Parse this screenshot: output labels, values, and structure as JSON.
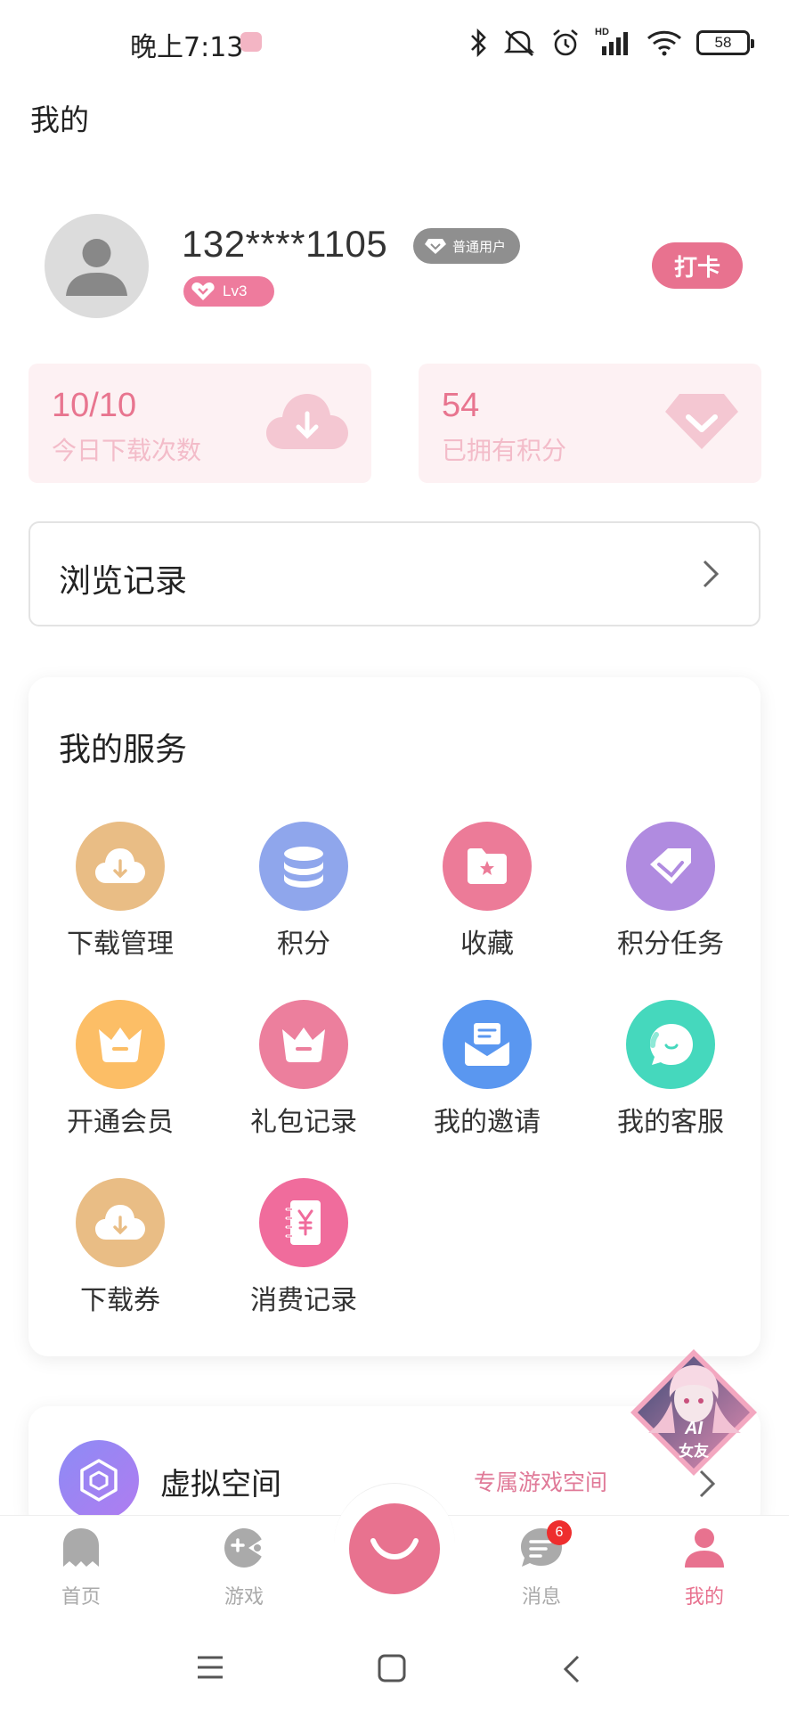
{
  "status_bar": {
    "time": "晚上7:13",
    "battery": "58",
    "network": "HD"
  },
  "page": {
    "title": "我的"
  },
  "profile": {
    "username": "132****1105",
    "user_type": "普通用户",
    "level": "Lv3",
    "checkin_label": "打卡"
  },
  "stats": [
    {
      "value": "10/10",
      "label": "今日下载次数",
      "icon": "cloud-download-icon"
    },
    {
      "value": "54",
      "label": "已拥有积分",
      "icon": "diamond-icon"
    }
  ],
  "history": {
    "label": "浏览记录"
  },
  "services": {
    "title": "我的服务",
    "items": [
      {
        "label": "下载管理",
        "icon": "cloud-download-icon",
        "color": "#e9bd85"
      },
      {
        "label": "积分",
        "icon": "coins-stack-icon",
        "color": "#8fa6ec"
      },
      {
        "label": "收藏",
        "icon": "star-folder-icon",
        "color": "#ec7b98"
      },
      {
        "label": "积分任务",
        "icon": "diamond-icon",
        "color": "#b08be0"
      },
      {
        "label": "开通会员",
        "icon": "crown-icon",
        "color": "#fcbe66"
      },
      {
        "label": "礼包记录",
        "icon": "crown-icon",
        "color": "#ec7f9d"
      },
      {
        "label": "我的邀请",
        "icon": "mail-icon",
        "color": "#5a97f0"
      },
      {
        "label": "我的客服",
        "icon": "chat-bubble-icon",
        "color": "#45d8bd"
      },
      {
        "label": "下载券",
        "icon": "cloud-download-icon",
        "color": "#e9bd85"
      },
      {
        "label": "消费记录",
        "icon": "yuan-notebook-icon",
        "color": "#f06c9c"
      }
    ]
  },
  "virtual_space": {
    "title": "虚拟空间",
    "subtitle": "专属游戏空间"
  },
  "ai_float": {
    "label_line1": "AI",
    "label_line2": "女友"
  },
  "bottom_nav": {
    "items": [
      {
        "label": "首页",
        "icon": "ghost-icon",
        "active": false
      },
      {
        "label": "游戏",
        "icon": "pacman-icon",
        "active": false
      },
      {
        "label": "消息",
        "icon": "message-icon",
        "active": false,
        "badge": "6"
      },
      {
        "label": "我的",
        "icon": "user-icon",
        "active": true
      }
    ]
  },
  "colors": {
    "accent": "#e8728f",
    "inactive": "#aaaaaa"
  }
}
